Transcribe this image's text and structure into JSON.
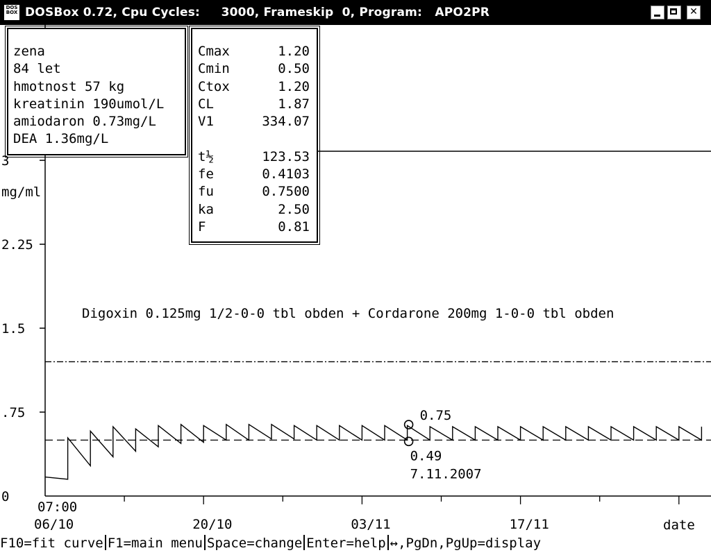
{
  "window": {
    "title": "DOSBox 0.72, Cpu Cycles:     3000, Frameskip  0, Program:   APO2PR",
    "icon_text": "DOS BOX"
  },
  "patient": {
    "lines": [
      "zena",
      "84 let",
      "hmotnost 57 kg",
      "kreatinin 190umol/L",
      "amiodaron 0.73mg/L",
      "DEA 1.36mg/L"
    ]
  },
  "params": {
    "group1": [
      {
        "k": "Cmax",
        "v": "1.20"
      },
      {
        "k": "Cmin",
        "v": "0.50"
      },
      {
        "k": "Ctox",
        "v": "1.20"
      },
      {
        "k": "CL",
        "v": "1.87"
      },
      {
        "k": "V1",
        "v": "334.07"
      }
    ],
    "group2": [
      {
        "k": "t½",
        "v": "123.53"
      },
      {
        "k": "fe",
        "v": "0.4103"
      },
      {
        "k": "fu",
        "v": "0.7500"
      },
      {
        "k": "ka",
        "v": "2.50"
      },
      {
        "k": "F",
        "v": "0.81"
      }
    ]
  },
  "chart": {
    "y_unit": "mg/ml",
    "y_ticks": [
      {
        "value": 0,
        "label": "0"
      },
      {
        "value": 0.75,
        "label": ".75"
      },
      {
        "value": 1.5,
        "label": "1.5"
      },
      {
        "value": 2.25,
        "label": "2.25"
      },
      {
        "value": 3,
        "label": "3"
      }
    ],
    "regimen": "Digoxin 0.125mg 1/2-0-0 tbl obden + Cordarone 200mg 1-0-0 tbl obden",
    "x_time": "07:00",
    "x_ticks": [
      {
        "day": 0,
        "label": "06/10"
      },
      {
        "day": 14,
        "label": "20/10"
      },
      {
        "day": 28,
        "label": "03/11"
      },
      {
        "day": 42,
        "label": "17/11"
      }
    ],
    "x_axis_label": "date",
    "measurement": {
      "value_label": "0.75",
      "value": 0.75,
      "day": 32
    },
    "predicted": {
      "value_label": "0.49",
      "value": 0.5,
      "day": 32,
      "date": "7.11.2007"
    }
  },
  "chart_data": {
    "type": "line",
    "ylabel": "mg/ml",
    "xlabel": "date",
    "ylim": [
      0,
      3
    ],
    "x_range_days": [
      0,
      58
    ],
    "x_tick_labels": [
      "06/10",
      "20/10",
      "03/11",
      "17/11"
    ],
    "y_tick_labels": [
      "0",
      ".75",
      "1.5",
      "2.25",
      "3"
    ],
    "reference_lines": [
      {
        "name": "Cmax",
        "value": 1.2
      },
      {
        "name": "Cmin",
        "value": 0.5
      },
      {
        "name": "Ctox",
        "value": 1.2
      }
    ],
    "dose_interval_days": 2,
    "series": [
      {
        "peaks": [
          0.4,
          0.52,
          0.58,
          0.62,
          0.6,
          0.63,
          0.64,
          0.63,
          0.64,
          0.64,
          0.64,
          0.63,
          0.63,
          0.63,
          0.63,
          0.63,
          0.63,
          0.62,
          0.62,
          0.62,
          0.62,
          0.62,
          0.62,
          0.62,
          0.62,
          0.62,
          0.62,
          0.62,
          0.62
        ],
        "troughs": [
          0.15,
          0.27,
          0.35,
          0.4,
          0.44,
          0.47,
          0.48,
          0.5,
          0.5,
          0.51,
          0.51,
          0.5,
          0.5,
          0.5,
          0.5,
          0.5,
          0.5,
          0.5,
          0.5,
          0.5,
          0.5,
          0.5,
          0.5,
          0.5,
          0.5,
          0.5,
          0.5,
          0.5,
          0.5
        ]
      }
    ],
    "points": [
      {
        "label": "0.75",
        "x_day": 32,
        "y": 0.75,
        "kind": "measured"
      },
      {
        "label": "0.49",
        "x_day": 32,
        "y": 0.5,
        "kind": "predicted",
        "date": "7.11.2007"
      }
    ]
  },
  "statusbar": {
    "items": [
      "F10=fit curve",
      "F1=main menu",
      "Space=change",
      "Enter=help",
      "↔,PgDn,PgUp=display"
    ]
  }
}
